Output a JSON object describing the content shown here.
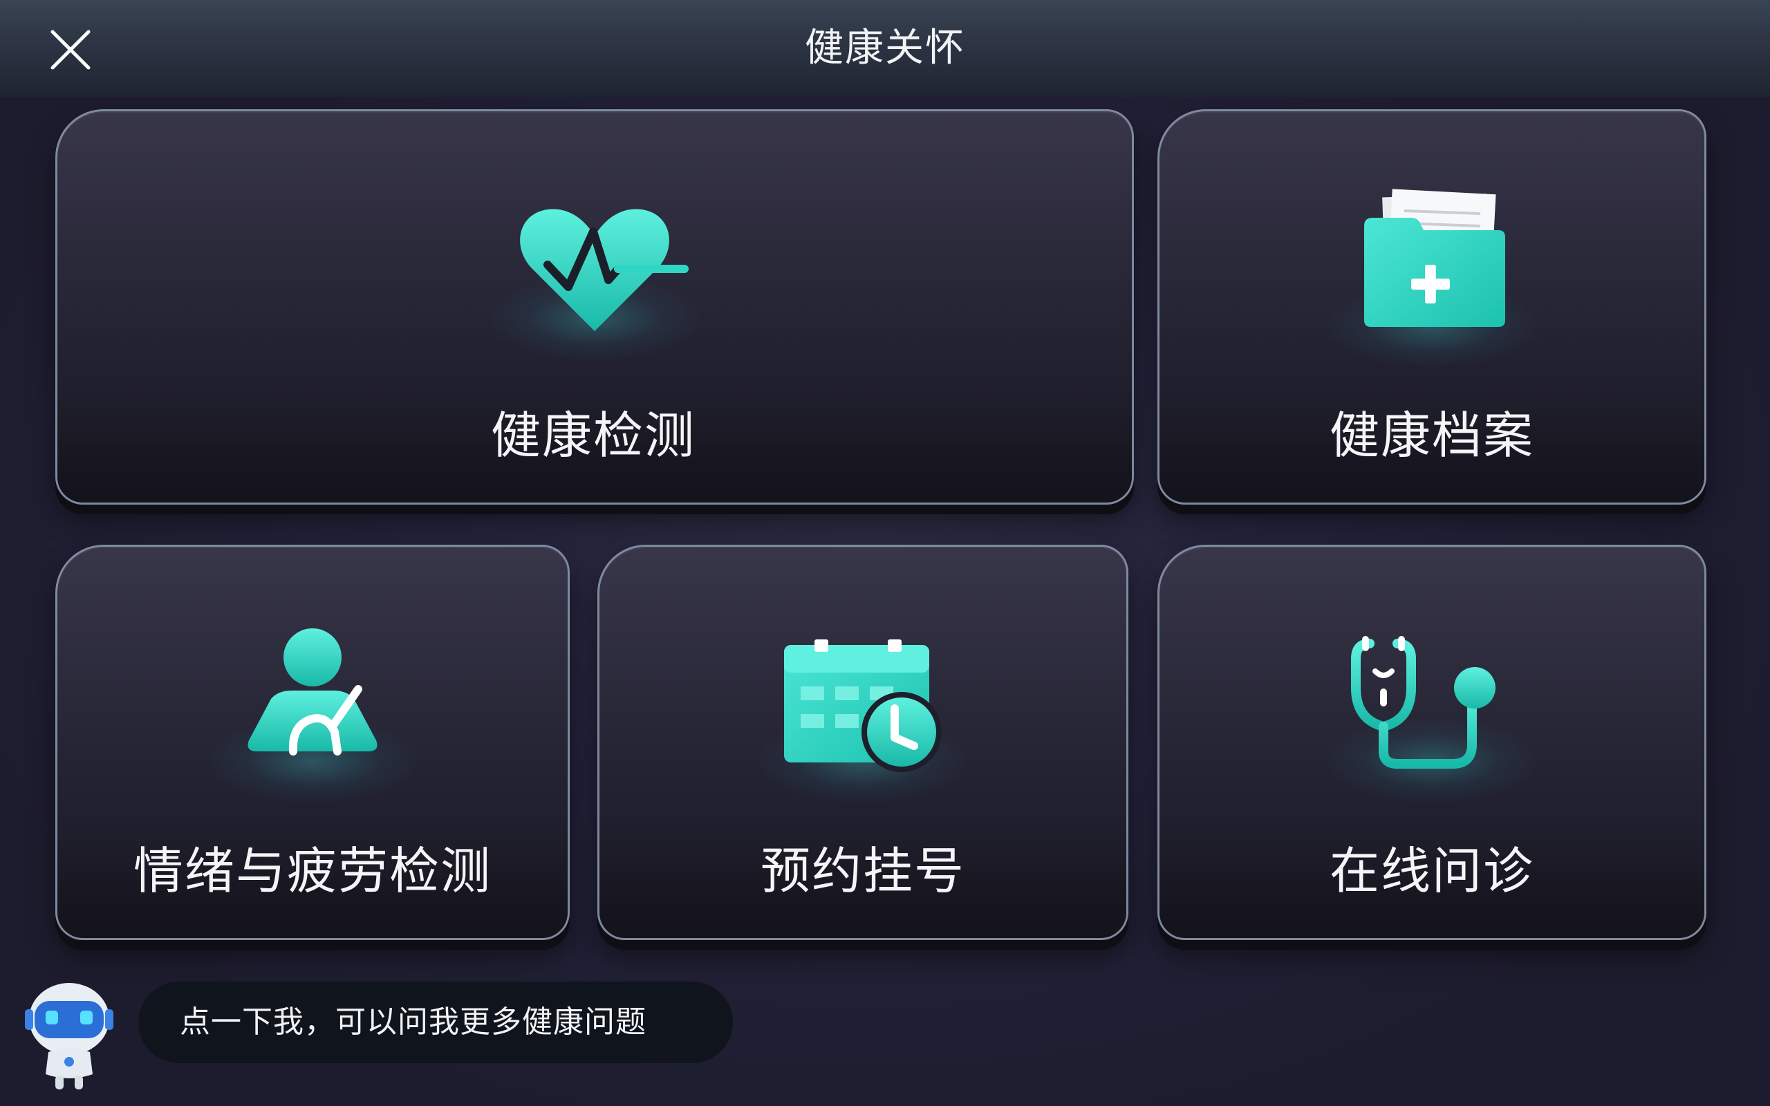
{
  "header": {
    "title": "健康关怀",
    "close_icon": "close-icon"
  },
  "cards": {
    "health_check": {
      "label": "健康检测",
      "icon": "heart-pulse-icon"
    },
    "health_records": {
      "label": "健康档案",
      "icon": "medical-folder-icon"
    },
    "emotion_fatigue": {
      "label": "情绪与疲劳检测",
      "icon": "person-seatbelt-icon"
    },
    "appointment": {
      "label": "预约挂号",
      "icon": "calendar-clock-icon"
    },
    "online_consult": {
      "label": "在线问诊",
      "icon": "stethoscope-icon"
    }
  },
  "assistant": {
    "icon": "robot-avatar-icon",
    "hint": "点一下我，可以问我更多健康问题"
  },
  "colors": {
    "accent": "#2fd6c4",
    "background": "#1f1e30",
    "card_border": "#7e8aa0"
  }
}
